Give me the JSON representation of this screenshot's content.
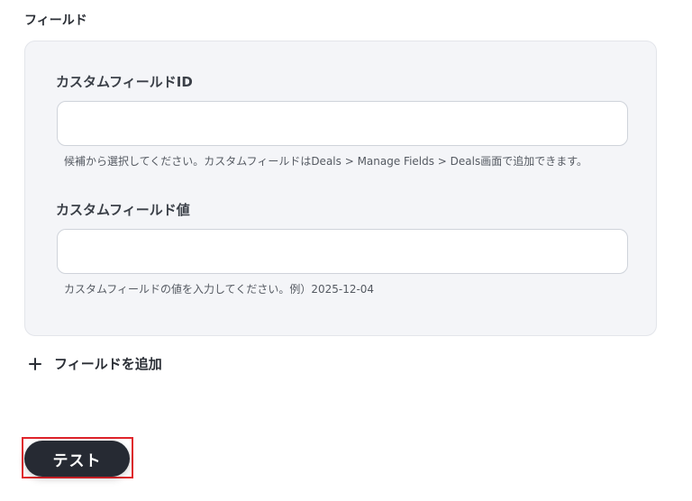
{
  "section": {
    "title": "フィールド"
  },
  "fields": [
    {
      "label": "カスタムフィールドID",
      "value": "",
      "placeholder": "",
      "help": "候補から選択してください。カスタムフィールドはDeals > Manage Fields > Deals画面で追加できます。"
    },
    {
      "label": "カスタムフィールド値",
      "value": "",
      "placeholder": "",
      "help": "カスタムフィールドの値を入力してください。例）2025-12-04"
    }
  ],
  "actions": {
    "add_field_label": "フィールドを追加",
    "add_field_icon": "plus-icon",
    "test_label": "テスト"
  },
  "colors": {
    "card_background": "#f4f5f8",
    "button_background": "#262a33",
    "highlight": "#e0242b"
  }
}
